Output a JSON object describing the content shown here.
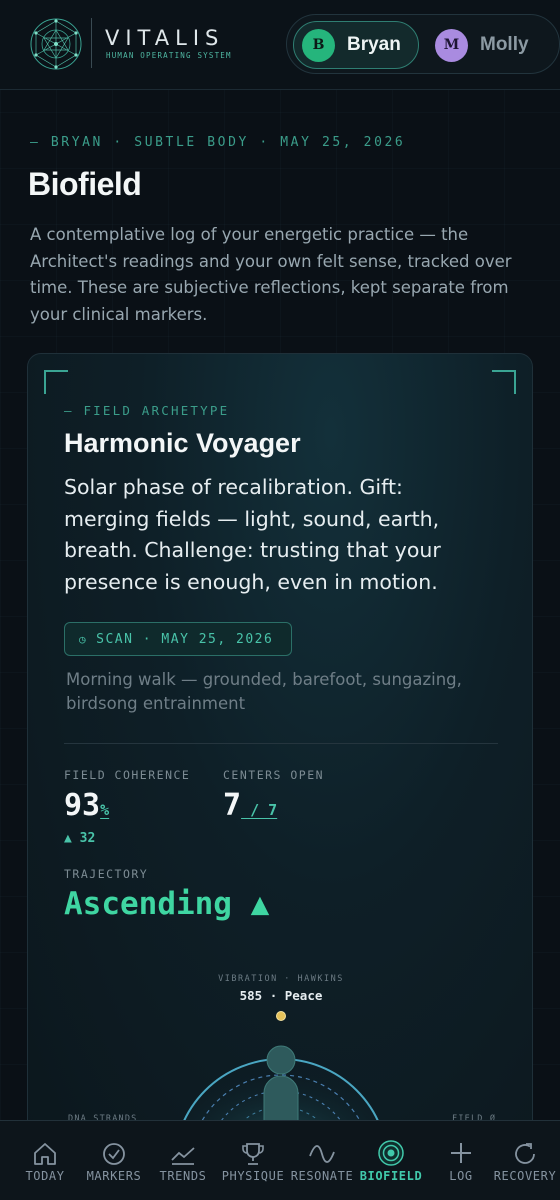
{
  "header": {
    "brand_name": "VITALIS",
    "brand_tagline": "HUMAN OPERATING SYSTEM",
    "logo_icon": "geometric-constellation-icon",
    "users": [
      {
        "initial": "B",
        "name": "Bryan",
        "active": true,
        "color": "#25b57c"
      },
      {
        "initial": "M",
        "name": "Molly",
        "active": false,
        "color": "#a98be0"
      }
    ]
  },
  "page": {
    "eyebrow": "— BRYAN · SUBTLE BODY · MAY 25, 2026",
    "title": "Biofield",
    "intro": "A contemplative log of your energetic practice — the Architect's readings and your own felt sense, tracked over time. These are subjective reflections, kept separate from your clinical markers."
  },
  "card": {
    "eyebrow": "— FIELD ARCHETYPE",
    "archetype": "Harmonic Voyager",
    "description": "Solar phase of recalibration. Gift: merging fields — light, sound, earth, breath. Challenge: trusting that your presence is enough, even in motion.",
    "scan_label": "SCAN · MAY 25, 2026",
    "scan_note": "Morning walk — grounded, barefoot, sungazing, birdsong entrainment",
    "coherence_label": "FIELD COHERENCE",
    "coherence_value": "93",
    "coherence_unit": "%",
    "coherence_delta": "▲ 32",
    "centers_label": "CENTERS OPEN",
    "centers_value": "7",
    "centers_total": " / 7",
    "trajectory_label": "TRAJECTORY",
    "trajectory_value": "Ascending ▲",
    "vibration_label": "VIBRATION · HAWKINS",
    "vibration_value": "585 · Peace",
    "left_side_label": "DNA STRANDS",
    "right_side_label": "FIELD Ø"
  },
  "nav": [
    {
      "label": "TODAY",
      "icon": "home-icon",
      "active": false
    },
    {
      "label": "MARKERS",
      "icon": "check-circle-icon",
      "active": false
    },
    {
      "label": "TRENDS",
      "icon": "trend-line-icon",
      "active": false
    },
    {
      "label": "PHYSIQUE",
      "icon": "trophy-icon",
      "active": false
    },
    {
      "label": "RESONATE",
      "icon": "wave-icon",
      "active": false
    },
    {
      "label": "BIOFIELD",
      "icon": "target-rings-icon",
      "active": true
    },
    {
      "label": "LOG",
      "icon": "plus-icon",
      "active": false
    },
    {
      "label": "RECOVERY",
      "icon": "refresh-icon",
      "active": false
    }
  ],
  "colors": {
    "accent": "#41c9ab",
    "trajectory": "#3fd6a2",
    "background": "#0a1016"
  }
}
